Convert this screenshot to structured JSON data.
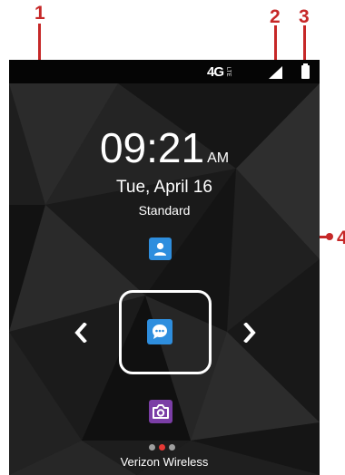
{
  "callouts": [
    "1",
    "2",
    "3",
    "4"
  ],
  "status_bar": {
    "network": "4G",
    "network_sub": "LTE",
    "signal": "signal-icon",
    "battery": "battery-icon"
  },
  "clock": {
    "time": "09:21",
    "ampm": "AM"
  },
  "date": "Tue, April 16",
  "profile": "Standard",
  "apps": {
    "contacts": "contacts-icon",
    "messaging": "messaging-icon",
    "camera": "camera-icon"
  },
  "page_indicator": {
    "count": 3,
    "active": 2
  },
  "carrier": "Verizon Wireless",
  "colors": {
    "callout": "#c62828",
    "app_blue": "#2e8ede",
    "app_purple": "#7b3ea6",
    "dot_active": "#e53935"
  }
}
